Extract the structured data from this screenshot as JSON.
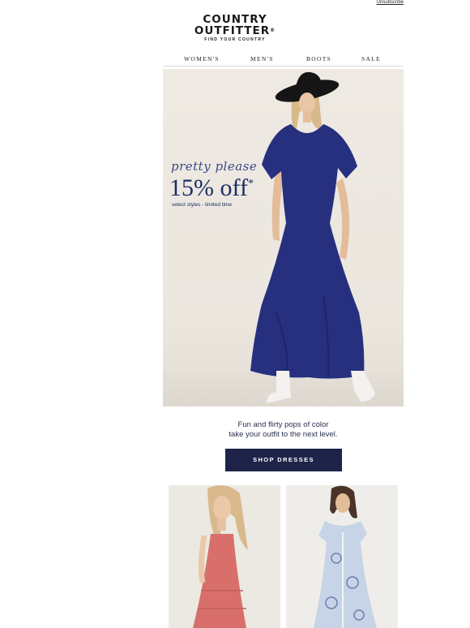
{
  "header": {
    "unsubscribe": "Unsubscribe",
    "logo": {
      "line1": "COUNTRY",
      "line2": "OUTFITTER",
      "registered": "®",
      "tagline": "FIND YOUR COUNTRY"
    }
  },
  "nav": {
    "items": [
      "WOMEN'S",
      "MEN'S",
      "BOOTS",
      "SALE"
    ]
  },
  "hero": {
    "script_text": "pretty please",
    "discount": "15% off",
    "asterisk": "*",
    "fine_print": "select styles - limited  time"
  },
  "promo": {
    "line1": "Fun and flirty pops of color",
    "line2": "take your outfit to the next level."
  },
  "cta": {
    "label": "SHOP DRESSES"
  },
  "colors": {
    "navy": "#1d2349",
    "dress_blue": "#27307f",
    "pink_dress": "#d96f6a",
    "paisley_dress": "#c7d3e6"
  }
}
